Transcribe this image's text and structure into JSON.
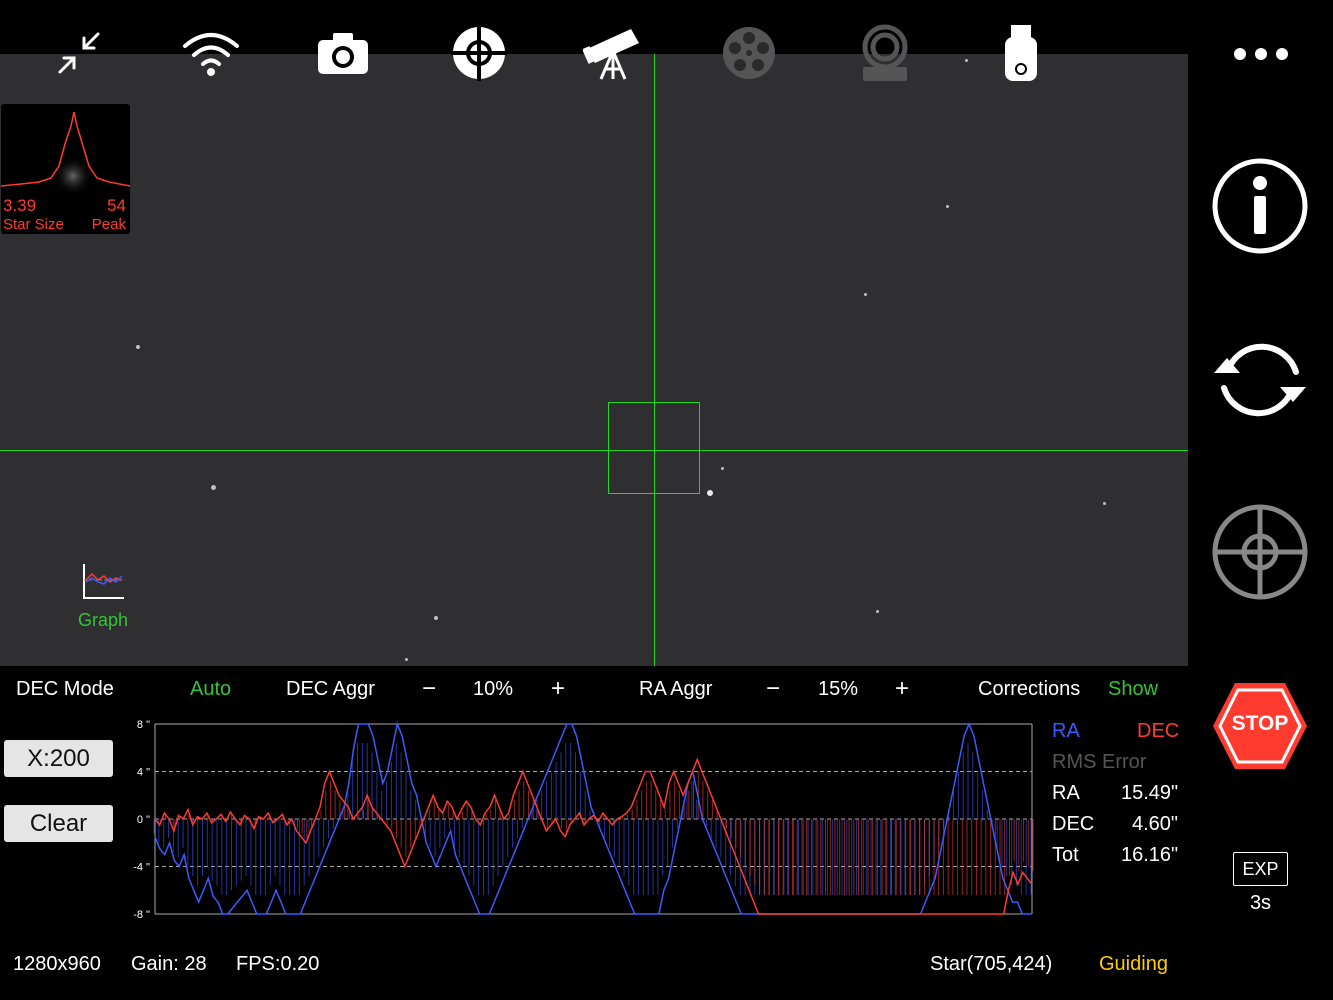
{
  "toolbar": {
    "icons": [
      "collapse-icon",
      "wifi-icon",
      "camera-icon",
      "target-crosshair-icon",
      "telescope-icon",
      "filter-wheel-icon",
      "focuser-icon",
      "usb-drive-icon"
    ]
  },
  "star_profile": {
    "size_value": "3.39",
    "size_label": "Star Size",
    "peak_value": "54",
    "peak_label": "Peak"
  },
  "graph_toggle": {
    "label": "Graph"
  },
  "controls": {
    "dec_mode_label": "DEC Mode",
    "dec_mode_value": "Auto",
    "dec_aggr_label": "DEC Aggr",
    "dec_aggr_minus": "−",
    "dec_aggr_value": "10%",
    "dec_aggr_plus": "+",
    "ra_aggr_label": "RA Aggr",
    "ra_aggr_minus": "−",
    "ra_aggr_value": "15%",
    "ra_aggr_plus": "+",
    "corrections_label": "Corrections",
    "corrections_value": "Show"
  },
  "buttons": {
    "scale": "X:200",
    "clear": "Clear"
  },
  "legend": {
    "ra": "RA",
    "dec": "DEC",
    "rms_label": "RMS Error",
    "rows": [
      {
        "label": "RA",
        "value": "15.49\""
      },
      {
        "label": "DEC",
        "value": "4.60\""
      },
      {
        "label": "Tot",
        "value": "16.16\""
      }
    ]
  },
  "colors": {
    "ra": "#3a5bff",
    "dec": "#ff3b30",
    "accent_green": "#35c435",
    "guiding": "#ffcc00"
  },
  "chart_data": {
    "type": "line",
    "yticks": [
      "8 \"",
      "4 \"",
      "0 \"",
      "-4 \"",
      "-8 \""
    ],
    "ylim": [
      -8,
      8
    ],
    "grid": true,
    "series": [
      {
        "name": "RA",
        "values": [
          -1.5,
          -2.5,
          -3,
          -2,
          -3.5,
          -4,
          -3,
          -5,
          -6,
          -7,
          -6,
          -5,
          -6.5,
          -7,
          -8,
          -8,
          -7.5,
          -7,
          -6.5,
          -6,
          -7,
          -8,
          -8,
          -8,
          -7,
          -6,
          -7,
          -8,
          -8,
          -8,
          -8,
          -7,
          -6,
          -5,
          -4,
          -3,
          -2,
          -1,
          0,
          1,
          3,
          6,
          8,
          8,
          8,
          7,
          5,
          3,
          4,
          6,
          8,
          7,
          5,
          3,
          2,
          0,
          -2,
          -3,
          -4,
          -3,
          -2,
          -1,
          -3,
          -4,
          -5,
          -6,
          -7,
          -8,
          -8,
          -8,
          -7,
          -6,
          -5,
          -4,
          -3,
          -2,
          -1,
          0,
          1,
          2,
          3,
          4,
          5,
          6,
          7,
          8,
          8,
          7,
          5,
          3,
          1,
          0,
          -1,
          -2,
          -3,
          -4,
          -5,
          -6,
          -7,
          -8,
          -8,
          -8,
          -8,
          -8,
          -8,
          -6,
          -5,
          -3,
          -1,
          1,
          3,
          4,
          2,
          0,
          -1,
          -2,
          -3,
          -4,
          -5,
          -6,
          -7,
          -8,
          -8,
          -8,
          -8,
          -8,
          -8,
          -8,
          -8,
          -8,
          -8,
          -8,
          -8,
          -8,
          -8,
          -8,
          -8,
          -8,
          -8,
          -8,
          -8,
          -8,
          -8,
          -8,
          -8,
          -8,
          -8,
          -8,
          -8,
          -8,
          -8,
          -8,
          -8,
          -8,
          -8,
          -8,
          -8,
          -8,
          -8,
          -7,
          -6,
          -5,
          -3,
          -1,
          1,
          3,
          5,
          7,
          8,
          7,
          5,
          3,
          1,
          -1,
          -3,
          -5,
          -6,
          -7,
          -7,
          -8,
          -8,
          -8
        ]
      },
      {
        "name": "DEC",
        "values": [
          0,
          -0.5,
          0.5,
          0,
          -1,
          0.3,
          0,
          0.8,
          -0.5,
          0.2,
          0,
          0.5,
          -0.3,
          0,
          0.4,
          -0.2,
          0.6,
          0,
          -0.5,
          0.3,
          0,
          -0.8,
          0.2,
          0,
          0.5,
          -0.3,
          0,
          0.4,
          -0.5,
          0,
          -1,
          -1.5,
          -2,
          -1,
          0,
          1,
          3,
          4,
          3,
          2,
          1.5,
          1,
          0,
          0.5,
          1,
          2,
          1,
          0.5,
          0,
          -0.5,
          -1,
          -2,
          -3,
          -4,
          -3,
          -2,
          -1,
          0,
          1,
          2,
          1,
          0.5,
          1.5,
          1,
          0,
          0.8,
          1.5,
          1,
          0,
          -0.5,
          0.5,
          1,
          2,
          1,
          0,
          0.5,
          2,
          3,
          4,
          3,
          2,
          1,
          0,
          -1,
          -0.5,
          0,
          -1,
          -1.5,
          -0.5,
          0,
          0.5,
          -0.5,
          0,
          0.3,
          -0.2,
          0.5,
          0,
          -0.5,
          0,
          0.2,
          0.5,
          1,
          2,
          3,
          4,
          4,
          3,
          2,
          1,
          3,
          4,
          3,
          2,
          3,
          4,
          5,
          4,
          3,
          2,
          1,
          0,
          -1,
          -2,
          -3,
          -4,
          -5,
          -6,
          -7,
          -8,
          -8,
          -8,
          -8,
          -8,
          -8,
          -8,
          -8,
          -8,
          -8,
          -8,
          -8,
          -8,
          -8,
          -8,
          -8,
          -8,
          -8,
          -8,
          -8,
          -8,
          -8,
          -8,
          -8,
          -8,
          -8,
          -8,
          -8,
          -8,
          -8,
          -8,
          -8,
          -8,
          -8,
          -8,
          -8,
          -8,
          -8,
          -8,
          -8,
          -8,
          -8,
          -8,
          -8,
          -8,
          -8,
          -8,
          -8,
          -8,
          -8,
          -8,
          -8,
          -8,
          -6,
          -4.5,
          -5.5,
          -4.5,
          -5,
          -5.5
        ]
      }
    ]
  },
  "right_panel": {
    "more_icon": "more-dots-icon",
    "info_icon": "info-icon",
    "refresh_icon": "refresh-loop-icon",
    "target_icon": "crosshair-target-icon",
    "stop_label": "STOP",
    "exp_label": "EXP",
    "exp_value": "3s"
  },
  "status": {
    "resolution": "1280x960",
    "gain": "Gain: 28",
    "fps": "FPS:0.20",
    "star": "Star(705,424)",
    "state": "Guiding"
  }
}
